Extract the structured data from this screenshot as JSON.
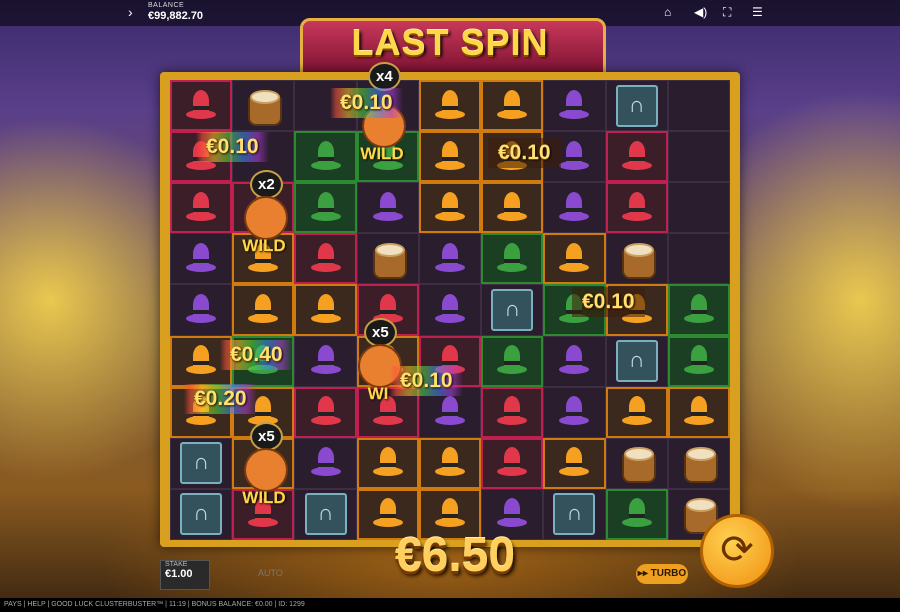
{
  "topbar": {
    "menu_chevron": "chevron-right-icon",
    "balance_label": "BALANCE",
    "balance_value": "€99,882.70",
    "icons": [
      "home-icon",
      "sound-icon",
      "fullscreen-icon",
      "menu-icon"
    ]
  },
  "title": "LAST SPIN",
  "grid": {
    "columns": 9,
    "rows": 9,
    "cells": [
      [
        "red",
        "pot",
        "wild",
        "wild",
        "orange",
        "orange",
        "purple",
        "shoe",
        ""
      ],
      [
        "red",
        "wild",
        "green",
        "green",
        "orange",
        "orange",
        "purple",
        "red",
        ""
      ],
      [
        "red",
        "red",
        "green",
        "purple",
        "orange",
        "orange",
        "purple",
        "red",
        ""
      ],
      [
        "purple",
        "orange",
        "red",
        "pot",
        "purple",
        "green",
        "orange",
        "pot",
        ""
      ],
      [
        "purple",
        "orange",
        "orange",
        "red",
        "purple",
        "shoe",
        "green",
        "orange",
        "green"
      ],
      [
        "orange",
        "green",
        "purple",
        "orange",
        "red",
        "green",
        "purple",
        "shoe",
        "green"
      ],
      [
        "orange",
        "orange",
        "red",
        "red",
        "purple",
        "red",
        "purple",
        "orange",
        "orange"
      ],
      [
        "shoe",
        "orange",
        "purple",
        "orange",
        "orange",
        "red",
        "orange",
        "pot",
        "pot"
      ],
      [
        "shoe",
        "red",
        "shoe",
        "orange",
        "orange",
        "purple",
        "shoe",
        "green",
        "pot"
      ]
    ]
  },
  "wilds": [
    {
      "multiplier": "x4",
      "label": "WILD"
    },
    {
      "multiplier": "x2",
      "label": "WILD"
    },
    {
      "multiplier": "x5",
      "label": "WILD"
    },
    {
      "multiplier": "x5",
      "label": "WI"
    }
  ],
  "wins": [
    "€0.10",
    "€0.10",
    "€0.10",
    "€0.10",
    "€0.40",
    "€0.10",
    "€0.20"
  ],
  "total_win": "€6.50",
  "controls": {
    "stake_label": "STAKE",
    "stake_value": "€1.00",
    "auto_label": "AUTO",
    "turbo_label": "TURBO",
    "spin_icon": "spin-icon"
  },
  "footer": "PAYS | HELP | GOOD LUCK CLUSTERBUSTER™ | 11:19 | BONUS BALANCE: €0.00 | ID: 1299"
}
